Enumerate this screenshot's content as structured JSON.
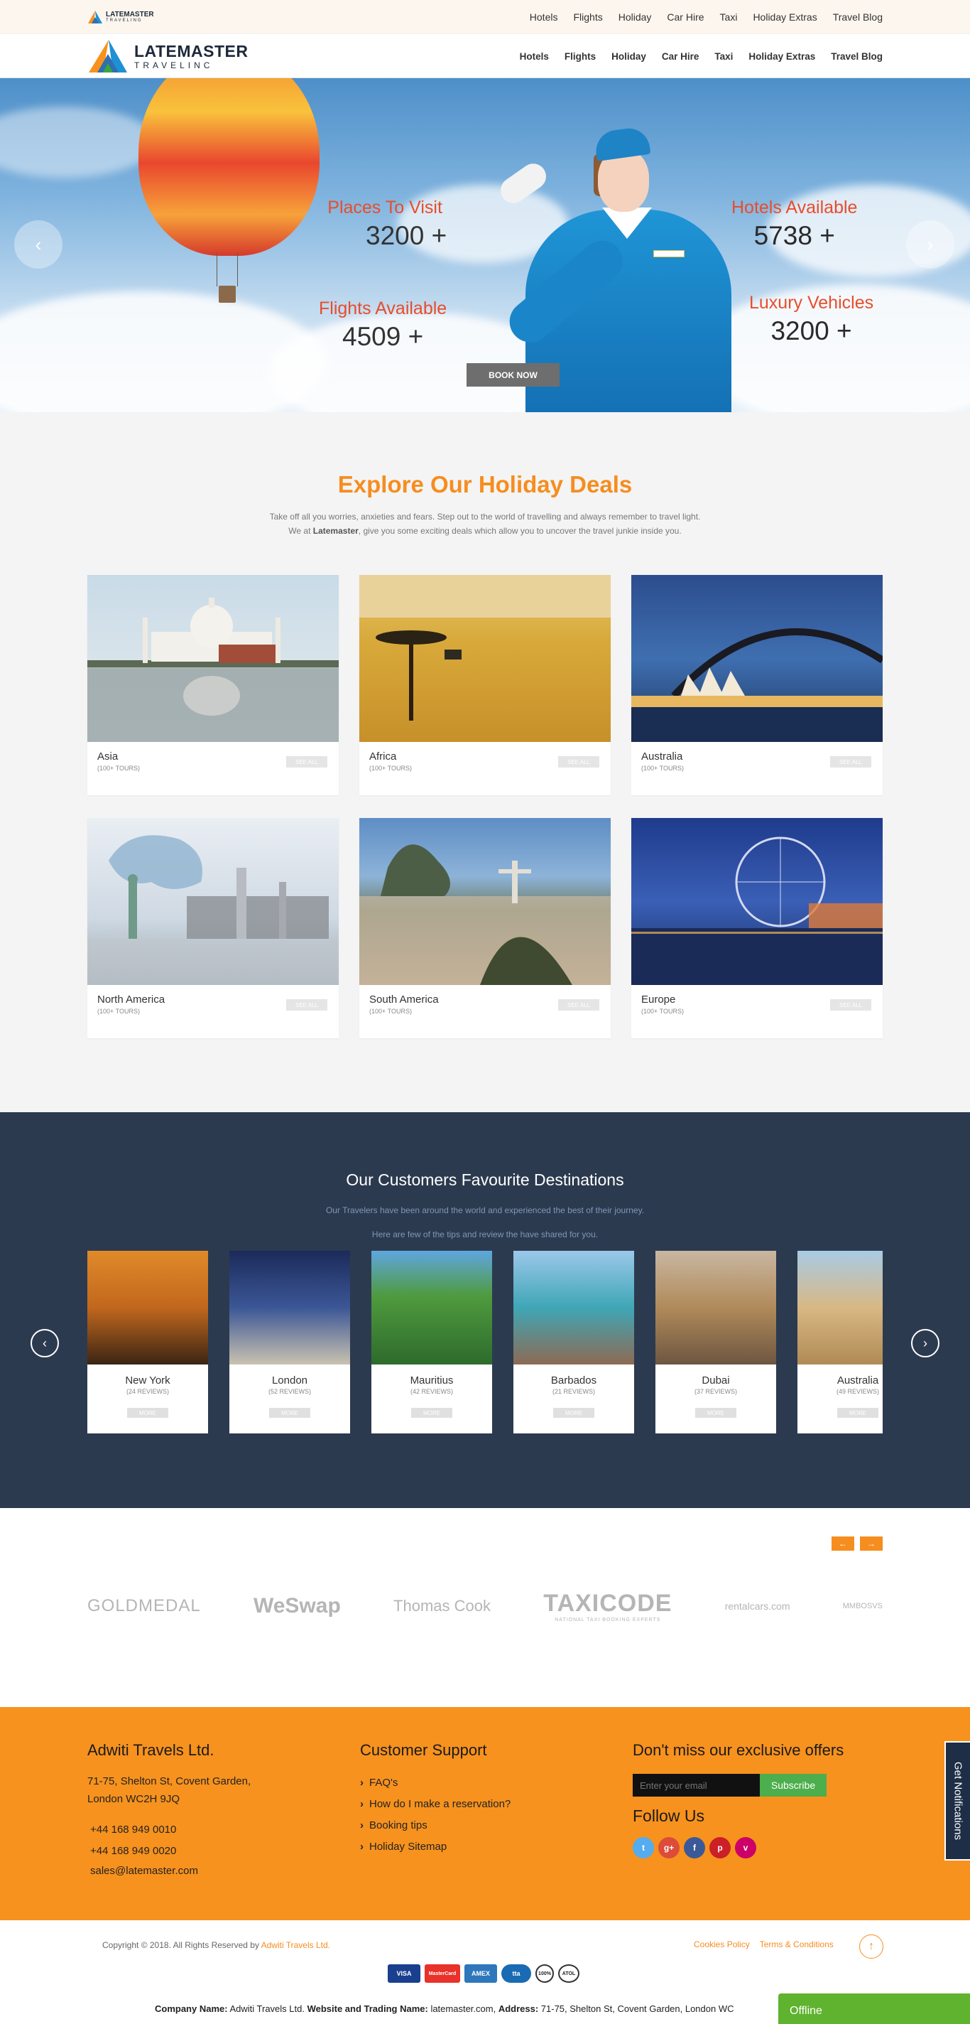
{
  "nav": [
    "Hotels",
    "Flights",
    "Holiday",
    "Car Hire",
    "Taxi",
    "Holiday Extras",
    "Travel Blog"
  ],
  "brand": {
    "name": "LATEMASTER",
    "sub": "TRAVELINC",
    "sub_small": "TRAVELING"
  },
  "hero": {
    "stats": [
      {
        "label": "Places To Visit",
        "value": "3200 +"
      },
      {
        "label": "Hotels Available",
        "value": "5738 +"
      },
      {
        "label": "Flights Available",
        "value": "4509 +"
      },
      {
        "label": "Luxury Vehicles",
        "value": "3200 +"
      }
    ],
    "book_now": "BOOK NOW",
    "prev": "‹",
    "next": "›"
  },
  "deals": {
    "title": "Explore Our Holiday Deals",
    "desc_line1": "Take off all you worries, anxieties and fears. Step out to the world of travelling and always remember to travel light.",
    "desc_line2_pre": "We at ",
    "desc_line2_brand": "Latemaster",
    "desc_line2_post": ", give you some exciting deals which allow you to uncover the travel junkie inside you.",
    "see_all": "SEE ALL",
    "items": [
      {
        "name": "Asia",
        "count": "(100+ TOURS)"
      },
      {
        "name": "Africa",
        "count": "(100+ TOURS)"
      },
      {
        "name": "Australia",
        "count": "(100+ TOURS)"
      },
      {
        "name": "North America",
        "count": "(100+ TOURS)"
      },
      {
        "name": "South America",
        "count": "(100+ TOURS)"
      },
      {
        "name": "Europe",
        "count": "(100+ TOURS)"
      }
    ]
  },
  "favs": {
    "title": "Our Customers Favourite Destinations",
    "p1": "Our Travelers have been around the world and experienced the best of their journey.",
    "p2": "Here are few of the tips and review the have shared for you.",
    "more": "MORE",
    "items": [
      {
        "name": "New York",
        "reviews": "(24 REVIEWS)"
      },
      {
        "name": "London",
        "reviews": "(52 REVIEWS)"
      },
      {
        "name": "Mauritius",
        "reviews": "(42 REVIEWS)"
      },
      {
        "name": "Barbados",
        "reviews": "(21 REVIEWS)"
      },
      {
        "name": "Dubai",
        "reviews": "(37 REVIEWS)"
      },
      {
        "name": "Australia",
        "reviews": "(49 REVIEWS)"
      }
    ]
  },
  "partners": [
    "GOLDMEDAL",
    "WeSwap",
    "Thomas Cook",
    "TAXICODE",
    "rentalcars.com",
    "MMBOSVS"
  ],
  "taxicode_sub": "NATIONAL TAXI BOOKING EXPERTS",
  "footer": {
    "company": "Adwiti Travels Ltd.",
    "addr1": "71-75, Shelton St, Covent Garden,",
    "addr2": "London WC2H 9JQ",
    "phone1": "+44 168 949 0010",
    "phone2": "+44 168 949 0020",
    "email": "sales@latemaster.com",
    "support_title": "Customer Support",
    "support_links": [
      "FAQ's",
      "How do I make a reservation?",
      "Booking tips",
      "Holiday Sitemap"
    ],
    "offers_title": "Don't miss our exclusive offers",
    "email_placeholder": "Enter your email",
    "subscribe": "Subscribe",
    "follow": "Follow Us",
    "social_colors": [
      "#55acee",
      "#dd4b39",
      "#3b5998",
      "#cb2027",
      "#cc0066"
    ],
    "notifications": "Get Notifications"
  },
  "bottom": {
    "copyright_pre": "Copyright © 2018. All Rights Reserved by ",
    "copyright_link": "Adwiti Travels Ltd.",
    "cookies": "Cookies Policy",
    "terms": "Terms & Conditions",
    "top": "↑",
    "payments": [
      "VISA",
      "MasterCard",
      "AMEX",
      "tta",
      "100%",
      "ATOL"
    ],
    "company_label": "Company Name:",
    "company_value": " Adwiti Travels Ltd. ",
    "trading_label": "Website and Trading Name:",
    "trading_value": " latemaster.com, ",
    "address_label": "Address:",
    "address_value": " 71-75, Shelton St, Covent Garden, London WC",
    "offline": "Offline"
  }
}
